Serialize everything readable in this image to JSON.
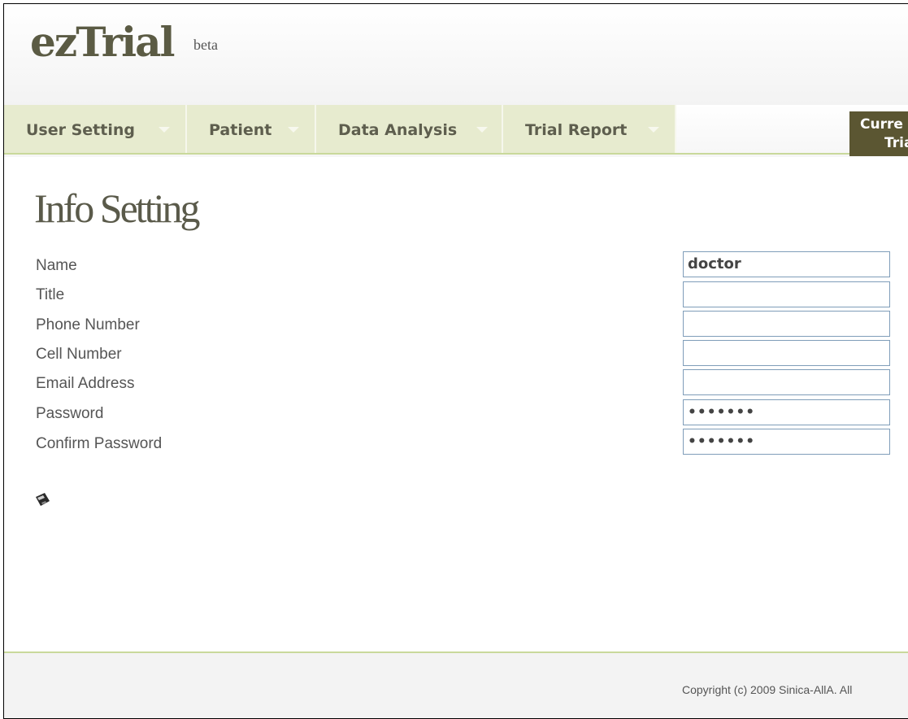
{
  "app": {
    "name": "ezTrial",
    "tag": "beta"
  },
  "nav": {
    "items": [
      {
        "label": "User Setting"
      },
      {
        "label": "Patient"
      },
      {
        "label": "Data Analysis"
      },
      {
        "label": "Trial Report"
      }
    ],
    "current_trial": {
      "line1": "Curre",
      "line2": "Tria"
    }
  },
  "page": {
    "title": "Info Setting"
  },
  "form": {
    "fields": [
      {
        "label": "Name",
        "value": "doctor"
      },
      {
        "label": "Title",
        "value": ""
      },
      {
        "label": "Phone Number",
        "value": ""
      },
      {
        "label": "Cell Number",
        "value": ""
      },
      {
        "label": "Email Address",
        "value": ""
      },
      {
        "label": "Password",
        "value": "•••••••"
      },
      {
        "label": "Confirm Password",
        "value": "•••••••"
      }
    ],
    "save_icon": "floppy-disk-icon"
  },
  "footer": {
    "copyright": "Copyright (c) 2009 Sinica-AllA. All"
  },
  "colors": {
    "nav_bg": "#e7ebcf",
    "accent_line": "#c9d99b",
    "current_trial_bg": "#5b5632",
    "input_border": "#7f9db9"
  }
}
